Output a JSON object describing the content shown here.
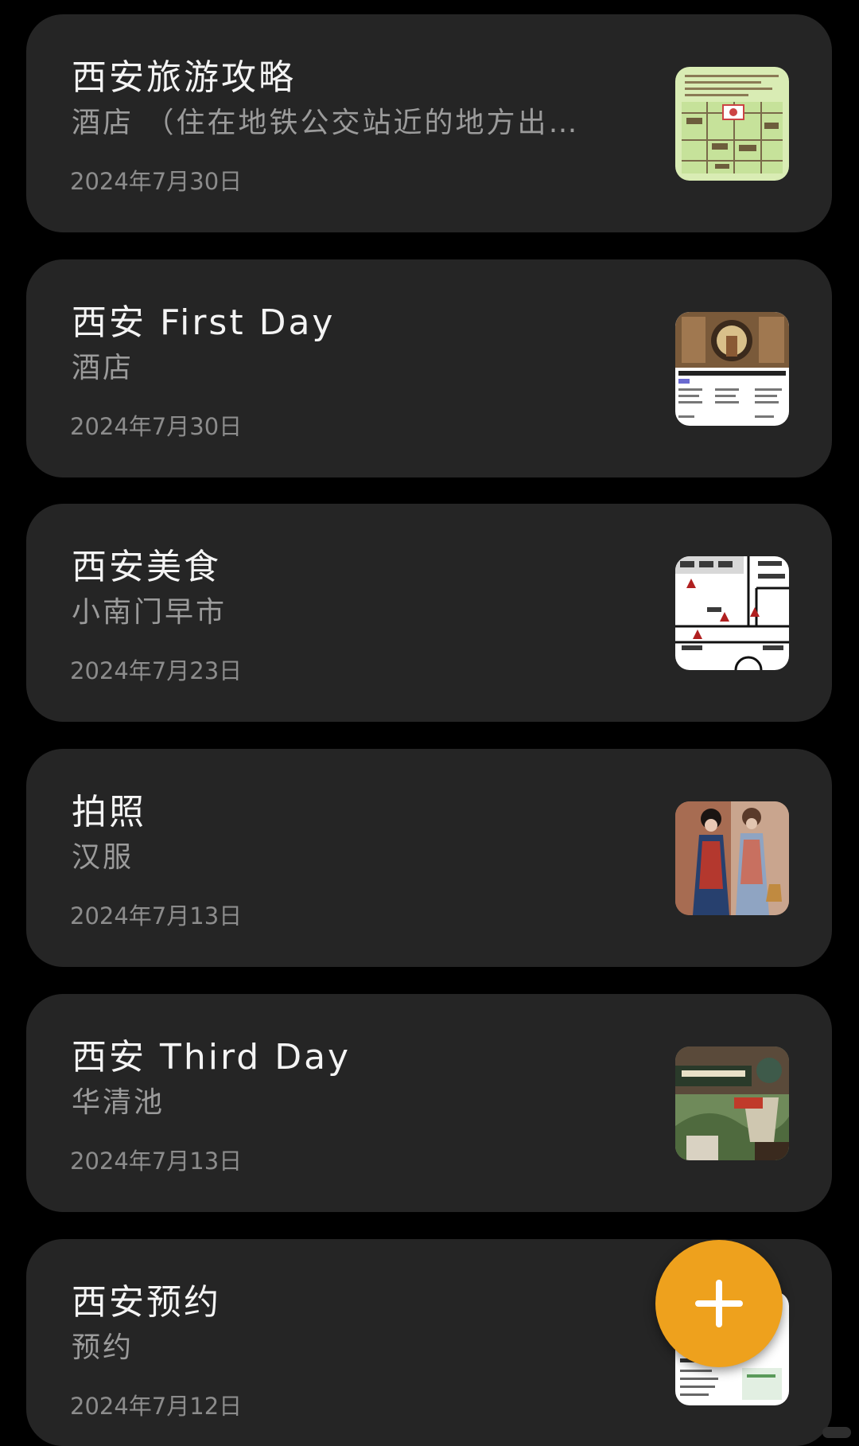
{
  "notes": [
    {
      "title": "西安旅游攻略",
      "snippet": "酒店 （住在地铁公交站近的地方出…",
      "date": "2024年7月30日",
      "thumbnail_icon": "map-thumbnail"
    },
    {
      "title": "西安 First Day",
      "snippet": "酒店",
      "date": "2024年7月30日",
      "thumbnail_icon": "hotel-listing-thumbnail"
    },
    {
      "title": "西安美食",
      "snippet": "小南门早市",
      "date": "2024年7月23日",
      "thumbnail_icon": "street-map-thumbnail"
    },
    {
      "title": "拍照",
      "snippet": "汉服",
      "date": "2024年7月13日",
      "thumbnail_icon": "hanfu-photo-thumbnail"
    },
    {
      "title": "西安 Third Day",
      "snippet": "华清池",
      "date": "2024年7月13日",
      "thumbnail_icon": "huaqing-palace-thumbnail"
    },
    {
      "title": "西安预约",
      "snippet": "预约",
      "date": "2024年7月12日",
      "thumbnail_icon": "reservation-screenshot-thumbnail"
    }
  ],
  "fab": {
    "icon": "plus-icon",
    "color": "#eea11d"
  },
  "colors": {
    "background": "#000000",
    "card": "#252525",
    "title": "#f4f4f4",
    "snippet": "#9b9b9b",
    "date": "#8c8c8c"
  }
}
